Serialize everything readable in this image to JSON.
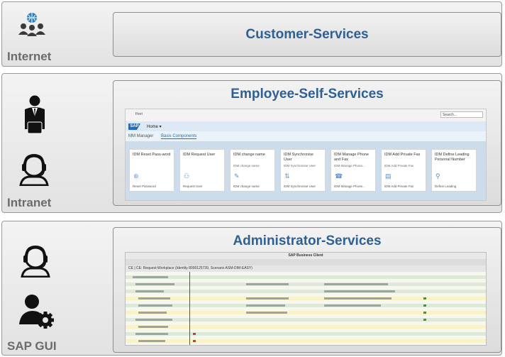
{
  "zones": {
    "internet": {
      "label": "Internet",
      "panel_title": "Customer-Services"
    },
    "intranet": {
      "label": "Intranet",
      "panel_title": "Employee-Self-Services"
    },
    "sapgui": {
      "label": "SAP GUI",
      "panel_title": "Administrator-Services"
    }
  },
  "ess_screenshot": {
    "browser_text": "Fiori",
    "search_placeholder": "Search...",
    "sap_logo": "SAP",
    "home_label": "Home ▾",
    "tabs": [
      "MM Manager",
      "Basis Components"
    ],
    "tiles": [
      {
        "title": "IDM Reset Pass-word",
        "subtitle": "",
        "footer": "Reset Password"
      },
      {
        "title": "IDM Request User",
        "subtitle": "",
        "footer": "Request User"
      },
      {
        "title": "IDM change name",
        "subtitle": "IDM change name",
        "footer": "IDM change name"
      },
      {
        "title": "IDM Synchronise User",
        "subtitle": "IDM Synchronise User",
        "footer": "IDM Synchronise User"
      },
      {
        "title": "IDM Manage Phone and Fax",
        "subtitle": "IDM Manage Phone...",
        "footer": "IDM Manage Phone..."
      },
      {
        "title": "IDM Add Private Fax",
        "subtitle": "IDM Add Private Fax",
        "footer": "IDM Add Private Fax"
      },
      {
        "title": "IDM Define Leading Personal Number",
        "subtitle": "",
        "footer": "Define Leading"
      }
    ]
  },
  "admin_screenshot": {
    "window_title": "SAP Business Client",
    "header_text": "CE | CE: Request-Workplace (Identity 8000125739, Scenario ASM-DIM-EASY)"
  },
  "colors": {
    "title_blue": "#2e5f95",
    "label_gray": "#6b6b6b",
    "tile_area": "#cddceb"
  }
}
